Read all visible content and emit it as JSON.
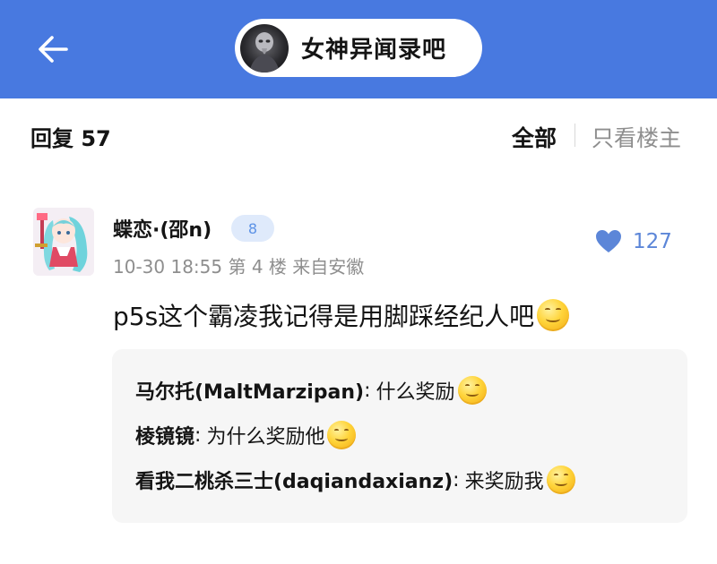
{
  "header": {
    "back_icon": "arrow-left-icon",
    "forum_name": "女神异闻录吧",
    "forum_avatar_icon": "forum-avatar-icon"
  },
  "thread": {
    "reply_label": "回复 57",
    "filters": {
      "all": "全部",
      "op_only": "只看楼主"
    }
  },
  "post": {
    "username": "蝶恋·(邵n)",
    "level": "8",
    "meta": "10-30 18:55 第 4 楼 来自安徽",
    "like_icon": "heart-icon",
    "like_count": "127",
    "content": "p5s这个霸凌我记得是用脚踩经纪人吧",
    "content_emoji": "smile-emoji"
  },
  "sub_replies": [
    {
      "author": "马尔托(MaltMarzipan)",
      "colon": ":",
      "text": "什么奖励",
      "emoji": "smile-emoji"
    },
    {
      "author": "棱镜镜",
      "colon": ":",
      "text": "为什么奖励他",
      "emoji": "smile-emoji"
    },
    {
      "author": "看我二桃杀三士(daqiandaxianz)",
      "colon": ":",
      "text": "来奖励我",
      "emoji": "smile-emoji"
    }
  ],
  "colors": {
    "header_bg": "#4879e0",
    "accent_blue": "#5c86d8",
    "level_badge_bg": "#dfeafb",
    "muted_text": "#8e8e8e",
    "subreply_bg": "#f6f6f6"
  }
}
